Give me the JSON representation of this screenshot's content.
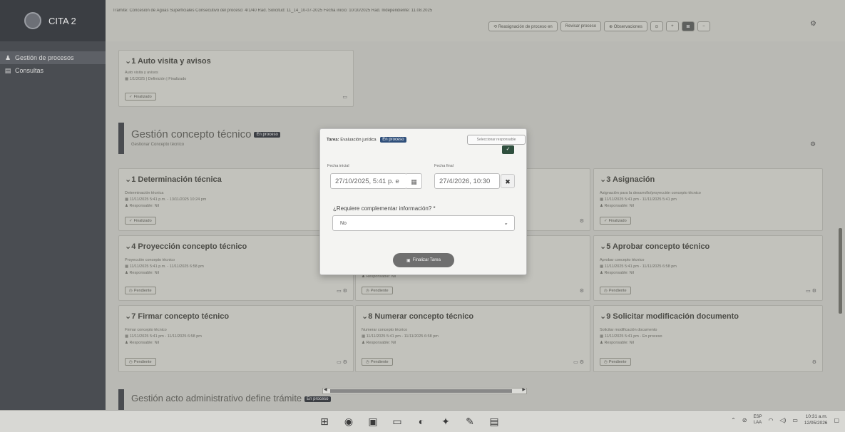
{
  "sidebar": {
    "brand": "CITA 2",
    "items": [
      {
        "icon": "person-icon",
        "label": "Gestión de procesos"
      },
      {
        "icon": "document-icon",
        "label": "Consultas"
      }
    ]
  },
  "header": {
    "process_info": "Trámite: Concesión de Aguas Superficiales  Consecutivo del proceso: 4/1/40  Rad. Solicitud: 11_14_10-07-2025  Fecha inicio: 10/10/2025  Rad. Independiente: 11.08.2025",
    "toolbar": [
      {
        "label": "⟲ Reasignación de proceso en",
        "kind": "normal"
      },
      {
        "label": "Revisar proceso",
        "kind": "normal"
      },
      {
        "label": "⊕ Observaciones",
        "kind": "normal"
      },
      {
        "label": "⊙",
        "kind": "small"
      },
      {
        "label": "+",
        "kind": "small"
      },
      {
        "label": "⊞",
        "kind": "dark"
      },
      {
        "label": "−",
        "kind": "small"
      }
    ]
  },
  "section0_card": {
    "title": "⌄1 Auto visita y avisos",
    "lines": [
      "Auto visita y avisos",
      "▦ 1/1/2025 | Definición | Finalizado"
    ],
    "status": "Finalizado"
  },
  "section1": {
    "title": "Gestión concepto técnico",
    "badge": "En proceso",
    "subtitle": "Gestionar Concepto técnico"
  },
  "cards": [
    {
      "title": "⌄1 Determinación técnica",
      "lines": [
        "Determinación técnica",
        "▦ 11/11/2025 5:41 p.m. - 13/11/2025 10:24 pm",
        "♟ Responsable: Nil"
      ],
      "status": "Finalizado"
    },
    {
      "title": "⌄3 Asignación",
      "lines": [
        "Asignación para la desarrollo/proyección concepto técnico",
        "▦ 11/11/2025 5:41 pm - 11/11/2025 5:41 pm",
        "♟ Responsable: Nil"
      ],
      "status": "Finalizado"
    },
    {
      "title": "⌄4 Proyección concepto técnico",
      "lines": [
        "Proyección concepto técnico",
        "▦ 11/11/2025 5:41 p.m. - 11/11/2025 6:58 pm",
        "♟ Responsable: Nil"
      ],
      "status": "Pendiente"
    },
    {
      "title": "",
      "lines": [
        "♟ Responsable: Nil"
      ],
      "status": "Pendiente"
    },
    {
      "title": "⌄5 Aprobar concepto técnico",
      "lines": [
        "Aprobar concepto técnico",
        "▦ 11/11/2025 5:41 pm - 11/11/2025 6:58 pm",
        "♟ Responsable: Nil"
      ],
      "status": "Pendiente"
    },
    {
      "title": "⌄7 Firmar concepto técnico",
      "lines": [
        "Firmar concepto técnico",
        "▦ 11/11/2025 5:41 pm - 11/11/2025 6:58 pm",
        "♟ Responsable: Nil"
      ],
      "status": "Pendiente"
    },
    {
      "title": "⌄8 Numerar concepto técnico",
      "lines": [
        "Numerar concepto técnico",
        "▦ 11/11/2025 5:41 pm - 11/11/2025 6:58 pm",
        "♟ Responsable: Nil"
      ],
      "status": "Pendiente"
    },
    {
      "title": "⌄9 Solicitar modificación documento",
      "lines": [
        "Solicitar modificación documento",
        "▦ 11/11/2025 5:41 pm - En proceso",
        "♟ Responsable: Nil"
      ],
      "status": "Pendiente"
    }
  ],
  "section2": {
    "title": "Gestión acto administrativo define trámite",
    "badge": "En proceso"
  },
  "modal": {
    "task_label": "Tarea:",
    "task_value": "Evaluación jurídica",
    "task_badge": "En proceso",
    "user_button": "Seleccionar responsable",
    "start_label": "Fecha inicial",
    "start_value": "27/10/2025, 5:41 p. e",
    "end_label": "Fecha final",
    "end_value": "27/4/2026, 10:30",
    "question": "¿Requiere complementar información? *",
    "select_value": "No",
    "save_label": "Finalizar Tarea"
  },
  "taskbar": {
    "lang_top": "ESP",
    "lang_bottom": "LAA",
    "time": "10:31 a.m.",
    "date": "12/05/2026"
  }
}
